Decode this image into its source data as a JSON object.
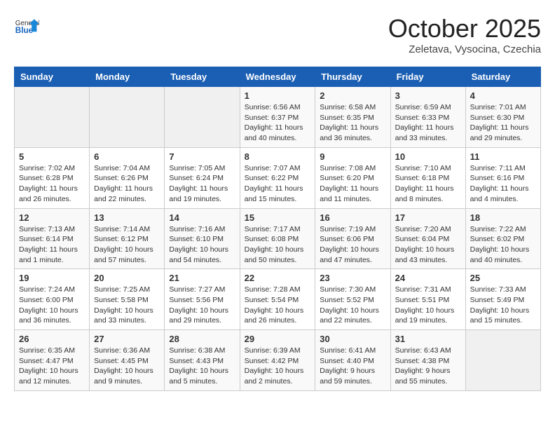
{
  "header": {
    "logo_general": "General",
    "logo_blue": "Blue",
    "month": "October 2025",
    "location": "Zeletava, Vysocina, Czechia"
  },
  "weekdays": [
    "Sunday",
    "Monday",
    "Tuesday",
    "Wednesday",
    "Thursday",
    "Friday",
    "Saturday"
  ],
  "weeks": [
    [
      {
        "day": "",
        "info": ""
      },
      {
        "day": "",
        "info": ""
      },
      {
        "day": "",
        "info": ""
      },
      {
        "day": "1",
        "info": "Sunrise: 6:56 AM\nSunset: 6:37 PM\nDaylight: 11 hours\nand 40 minutes."
      },
      {
        "day": "2",
        "info": "Sunrise: 6:58 AM\nSunset: 6:35 PM\nDaylight: 11 hours\nand 36 minutes."
      },
      {
        "day": "3",
        "info": "Sunrise: 6:59 AM\nSunset: 6:33 PM\nDaylight: 11 hours\nand 33 minutes."
      },
      {
        "day": "4",
        "info": "Sunrise: 7:01 AM\nSunset: 6:30 PM\nDaylight: 11 hours\nand 29 minutes."
      }
    ],
    [
      {
        "day": "5",
        "info": "Sunrise: 7:02 AM\nSunset: 6:28 PM\nDaylight: 11 hours\nand 26 minutes."
      },
      {
        "day": "6",
        "info": "Sunrise: 7:04 AM\nSunset: 6:26 PM\nDaylight: 11 hours\nand 22 minutes."
      },
      {
        "day": "7",
        "info": "Sunrise: 7:05 AM\nSunset: 6:24 PM\nDaylight: 11 hours\nand 19 minutes."
      },
      {
        "day": "8",
        "info": "Sunrise: 7:07 AM\nSunset: 6:22 PM\nDaylight: 11 hours\nand 15 minutes."
      },
      {
        "day": "9",
        "info": "Sunrise: 7:08 AM\nSunset: 6:20 PM\nDaylight: 11 hours\nand 11 minutes."
      },
      {
        "day": "10",
        "info": "Sunrise: 7:10 AM\nSunset: 6:18 PM\nDaylight: 11 hours\nand 8 minutes."
      },
      {
        "day": "11",
        "info": "Sunrise: 7:11 AM\nSunset: 6:16 PM\nDaylight: 11 hours\nand 4 minutes."
      }
    ],
    [
      {
        "day": "12",
        "info": "Sunrise: 7:13 AM\nSunset: 6:14 PM\nDaylight: 11 hours\nand 1 minute."
      },
      {
        "day": "13",
        "info": "Sunrise: 7:14 AM\nSunset: 6:12 PM\nDaylight: 10 hours\nand 57 minutes."
      },
      {
        "day": "14",
        "info": "Sunrise: 7:16 AM\nSunset: 6:10 PM\nDaylight: 10 hours\nand 54 minutes."
      },
      {
        "day": "15",
        "info": "Sunrise: 7:17 AM\nSunset: 6:08 PM\nDaylight: 10 hours\nand 50 minutes."
      },
      {
        "day": "16",
        "info": "Sunrise: 7:19 AM\nSunset: 6:06 PM\nDaylight: 10 hours\nand 47 minutes."
      },
      {
        "day": "17",
        "info": "Sunrise: 7:20 AM\nSunset: 6:04 PM\nDaylight: 10 hours\nand 43 minutes."
      },
      {
        "day": "18",
        "info": "Sunrise: 7:22 AM\nSunset: 6:02 PM\nDaylight: 10 hours\nand 40 minutes."
      }
    ],
    [
      {
        "day": "19",
        "info": "Sunrise: 7:24 AM\nSunset: 6:00 PM\nDaylight: 10 hours\nand 36 minutes."
      },
      {
        "day": "20",
        "info": "Sunrise: 7:25 AM\nSunset: 5:58 PM\nDaylight: 10 hours\nand 33 minutes."
      },
      {
        "day": "21",
        "info": "Sunrise: 7:27 AM\nSunset: 5:56 PM\nDaylight: 10 hours\nand 29 minutes."
      },
      {
        "day": "22",
        "info": "Sunrise: 7:28 AM\nSunset: 5:54 PM\nDaylight: 10 hours\nand 26 minutes."
      },
      {
        "day": "23",
        "info": "Sunrise: 7:30 AM\nSunset: 5:52 PM\nDaylight: 10 hours\nand 22 minutes."
      },
      {
        "day": "24",
        "info": "Sunrise: 7:31 AM\nSunset: 5:51 PM\nDaylight: 10 hours\nand 19 minutes."
      },
      {
        "day": "25",
        "info": "Sunrise: 7:33 AM\nSunset: 5:49 PM\nDaylight: 10 hours\nand 15 minutes."
      }
    ],
    [
      {
        "day": "26",
        "info": "Sunrise: 6:35 AM\nSunset: 4:47 PM\nDaylight: 10 hours\nand 12 minutes."
      },
      {
        "day": "27",
        "info": "Sunrise: 6:36 AM\nSunset: 4:45 PM\nDaylight: 10 hours\nand 9 minutes."
      },
      {
        "day": "28",
        "info": "Sunrise: 6:38 AM\nSunset: 4:43 PM\nDaylight: 10 hours\nand 5 minutes."
      },
      {
        "day": "29",
        "info": "Sunrise: 6:39 AM\nSunset: 4:42 PM\nDaylight: 10 hours\nand 2 minutes."
      },
      {
        "day": "30",
        "info": "Sunrise: 6:41 AM\nSunset: 4:40 PM\nDaylight: 9 hours\nand 59 minutes."
      },
      {
        "day": "31",
        "info": "Sunrise: 6:43 AM\nSunset: 4:38 PM\nDaylight: 9 hours\nand 55 minutes."
      },
      {
        "day": "",
        "info": ""
      }
    ]
  ]
}
